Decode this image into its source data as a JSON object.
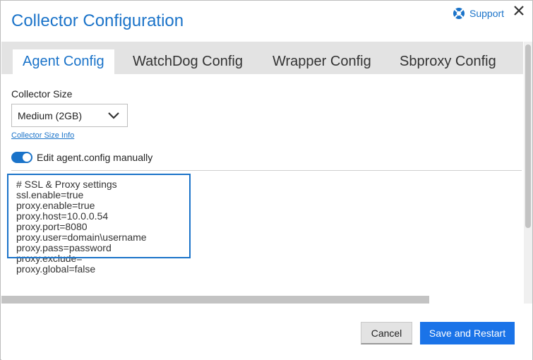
{
  "dialog": {
    "title": "Collector Configuration",
    "support_label": "Support",
    "close_icon": "close-icon",
    "support_icon": "lifebuoy-icon"
  },
  "tabs": [
    {
      "label": "Agent Config",
      "active": true
    },
    {
      "label": "WatchDog Config",
      "active": false
    },
    {
      "label": "Wrapper Config",
      "active": false
    },
    {
      "label": "Sbproxy Config",
      "active": false
    }
  ],
  "form": {
    "collector_size_label": "Collector Size",
    "collector_size_value": "Medium (2GB)",
    "collector_size_info": "Collector Size Info",
    "toggle_label": "Edit agent.config manually",
    "toggle_on": true
  },
  "editor": {
    "lines": [
      "# SSL & Proxy settings",
      "ssl.enable=true",
      "proxy.enable=true",
      "proxy.host=10.0.0.54",
      "proxy.port=8080",
      "proxy.user=domain\\username",
      "proxy.pass=password",
      "proxy.exclude=",
      "proxy.global=false"
    ]
  },
  "footer": {
    "cancel_label": "Cancel",
    "save_label": "Save and Restart"
  },
  "colors": {
    "accent": "#1a73c9",
    "primary_button": "#1a73e8",
    "tab_bar": "#e3e3e3"
  }
}
